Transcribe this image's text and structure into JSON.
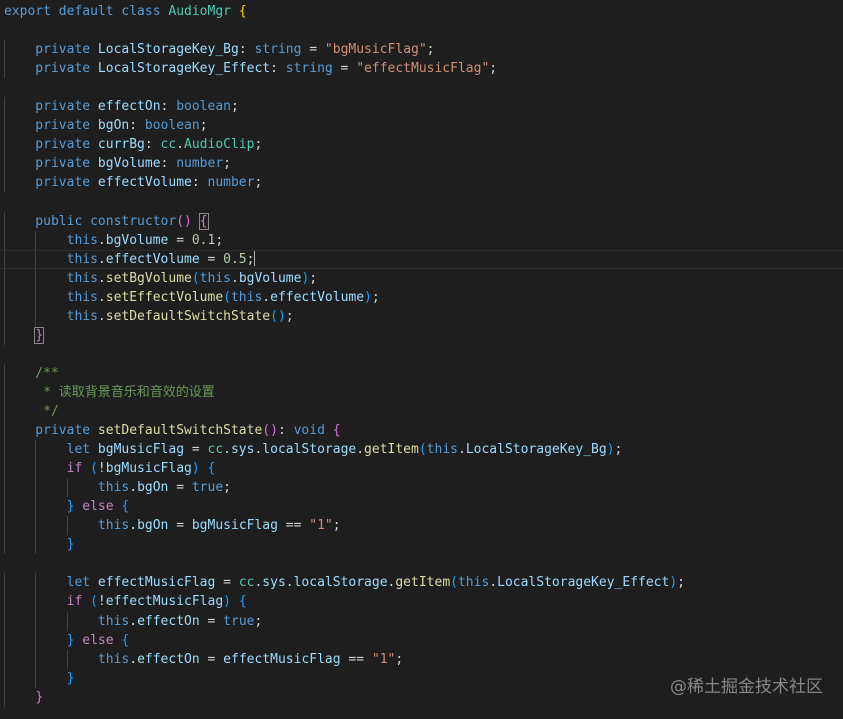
{
  "editor": {
    "lines": [
      [
        {
          "t": "export default class ",
          "c": "k"
        },
        {
          "t": "AudioMgr",
          "c": "cl"
        },
        {
          "t": " ",
          "c": "p"
        },
        {
          "t": "{",
          "c": "br1"
        }
      ],
      [],
      [
        {
          "t": "    private ",
          "c": "k"
        },
        {
          "t": "LocalStorageKey_Bg",
          "c": "v"
        },
        {
          "t": ": ",
          "c": "p"
        },
        {
          "t": "string",
          "c": "k"
        },
        {
          "t": " = ",
          "c": "p"
        },
        {
          "t": "\"bgMusicFlag\"",
          "c": "s"
        },
        {
          "t": ";",
          "c": "p"
        }
      ],
      [
        {
          "t": "    private ",
          "c": "k"
        },
        {
          "t": "LocalStorageKey_Effect",
          "c": "v"
        },
        {
          "t": ": ",
          "c": "p"
        },
        {
          "t": "string",
          "c": "k"
        },
        {
          "t": " = ",
          "c": "p"
        },
        {
          "t": "\"effectMusicFlag\"",
          "c": "s"
        },
        {
          "t": ";",
          "c": "p"
        }
      ],
      [],
      [
        {
          "t": "    private ",
          "c": "k"
        },
        {
          "t": "effectOn",
          "c": "v"
        },
        {
          "t": ": ",
          "c": "p"
        },
        {
          "t": "boolean",
          "c": "k"
        },
        {
          "t": ";",
          "c": "p"
        }
      ],
      [
        {
          "t": "    private ",
          "c": "k"
        },
        {
          "t": "bgOn",
          "c": "v"
        },
        {
          "t": ": ",
          "c": "p"
        },
        {
          "t": "boolean",
          "c": "k"
        },
        {
          "t": ";",
          "c": "p"
        }
      ],
      [
        {
          "t": "    private ",
          "c": "k"
        },
        {
          "t": "currBg",
          "c": "v"
        },
        {
          "t": ": ",
          "c": "p"
        },
        {
          "t": "cc",
          "c": "cl"
        },
        {
          "t": ".",
          "c": "p"
        },
        {
          "t": "AudioClip",
          "c": "cl"
        },
        {
          "t": ";",
          "c": "p"
        }
      ],
      [
        {
          "t": "    private ",
          "c": "k"
        },
        {
          "t": "bgVolume",
          "c": "v"
        },
        {
          "t": ": ",
          "c": "p"
        },
        {
          "t": "number",
          "c": "k"
        },
        {
          "t": ";",
          "c": "p"
        }
      ],
      [
        {
          "t": "    private ",
          "c": "k"
        },
        {
          "t": "effectVolume",
          "c": "v"
        },
        {
          "t": ": ",
          "c": "p"
        },
        {
          "t": "number",
          "c": "k"
        },
        {
          "t": ";",
          "c": "p"
        }
      ],
      [],
      [
        {
          "t": "    public ",
          "c": "k"
        },
        {
          "t": "constructor",
          "c": "k"
        },
        {
          "t": "() ",
          "c": "br2"
        },
        {
          "t": "{",
          "c": "br2 bm"
        }
      ],
      [
        {
          "t": "        this",
          "c": "k"
        },
        {
          "t": ".",
          "c": "p"
        },
        {
          "t": "bgVolume",
          "c": "v"
        },
        {
          "t": " = ",
          "c": "p"
        },
        {
          "t": "0.1",
          "c": "n"
        },
        {
          "t": ";",
          "c": "p"
        }
      ],
      [
        {
          "t": "        this",
          "c": "k"
        },
        {
          "t": ".",
          "c": "p"
        },
        {
          "t": "effectVolume",
          "c": "v"
        },
        {
          "t": " = ",
          "c": "p"
        },
        {
          "t": "0.5",
          "c": "n"
        },
        {
          "t": ";",
          "c": "p"
        },
        {
          "t": "",
          "c": "cursor"
        }
      ],
      [
        {
          "t": "        this",
          "c": "k"
        },
        {
          "t": ".",
          "c": "p"
        },
        {
          "t": "setBgVolume",
          "c": "f"
        },
        {
          "t": "(",
          "c": "br3"
        },
        {
          "t": "this",
          "c": "k"
        },
        {
          "t": ".",
          "c": "p"
        },
        {
          "t": "bgVolume",
          "c": "v"
        },
        {
          "t": ")",
          "c": "br3"
        },
        {
          "t": ";",
          "c": "p"
        }
      ],
      [
        {
          "t": "        this",
          "c": "k"
        },
        {
          "t": ".",
          "c": "p"
        },
        {
          "t": "setEffectVolume",
          "c": "f"
        },
        {
          "t": "(",
          "c": "br3"
        },
        {
          "t": "this",
          "c": "k"
        },
        {
          "t": ".",
          "c": "p"
        },
        {
          "t": "effectVolume",
          "c": "v"
        },
        {
          "t": ")",
          "c": "br3"
        },
        {
          "t": ";",
          "c": "p"
        }
      ],
      [
        {
          "t": "        this",
          "c": "k"
        },
        {
          "t": ".",
          "c": "p"
        },
        {
          "t": "setDefaultSwitchState",
          "c": "f"
        },
        {
          "t": "()",
          "c": "br3"
        },
        {
          "t": ";",
          "c": "p"
        }
      ],
      [
        {
          "t": "    ",
          "c": "p"
        },
        {
          "t": "}",
          "c": "br2 bm"
        }
      ],
      [],
      [
        {
          "t": "    /**",
          "c": "cm"
        }
      ],
      [
        {
          "t": "     * 读取背景音乐和音效的设置",
          "c": "cm"
        }
      ],
      [
        {
          "t": "     */",
          "c": "cm"
        }
      ],
      [
        {
          "t": "    private ",
          "c": "k"
        },
        {
          "t": "setDefaultSwitchState",
          "c": "f"
        },
        {
          "t": "()",
          "c": "br2"
        },
        {
          "t": ": ",
          "c": "p"
        },
        {
          "t": "void",
          "c": "k"
        },
        {
          "t": " ",
          "c": "p"
        },
        {
          "t": "{",
          "c": "br2"
        }
      ],
      [
        {
          "t": "        let ",
          "c": "k"
        },
        {
          "t": "bgMusicFlag",
          "c": "v"
        },
        {
          "t": " = ",
          "c": "p"
        },
        {
          "t": "cc",
          "c": "cl"
        },
        {
          "t": ".",
          "c": "p"
        },
        {
          "t": "sys",
          "c": "v"
        },
        {
          "t": ".",
          "c": "p"
        },
        {
          "t": "localStorage",
          "c": "v"
        },
        {
          "t": ".",
          "c": "p"
        },
        {
          "t": "getItem",
          "c": "f"
        },
        {
          "t": "(",
          "c": "br3"
        },
        {
          "t": "this",
          "c": "k"
        },
        {
          "t": ".",
          "c": "p"
        },
        {
          "t": "LocalStorageKey_Bg",
          "c": "v"
        },
        {
          "t": ")",
          "c": "br3"
        },
        {
          "t": ";",
          "c": "p"
        }
      ],
      [
        {
          "t": "        if ",
          "c": "kc"
        },
        {
          "t": "(",
          "c": "br3"
        },
        {
          "t": "!",
          "c": "p"
        },
        {
          "t": "bgMusicFlag",
          "c": "v"
        },
        {
          "t": ")",
          "c": "br3"
        },
        {
          "t": " ",
          "c": "p"
        },
        {
          "t": "{",
          "c": "br3"
        }
      ],
      [
        {
          "t": "            this",
          "c": "k"
        },
        {
          "t": ".",
          "c": "p"
        },
        {
          "t": "bgOn",
          "c": "v"
        },
        {
          "t": " = ",
          "c": "p"
        },
        {
          "t": "true",
          "c": "k"
        },
        {
          "t": ";",
          "c": "p"
        }
      ],
      [
        {
          "t": "        ",
          "c": "p"
        },
        {
          "t": "}",
          "c": "br3"
        },
        {
          "t": " else ",
          "c": "kc"
        },
        {
          "t": "{",
          "c": "br3"
        }
      ],
      [
        {
          "t": "            this",
          "c": "k"
        },
        {
          "t": ".",
          "c": "p"
        },
        {
          "t": "bgOn",
          "c": "v"
        },
        {
          "t": " = ",
          "c": "p"
        },
        {
          "t": "bgMusicFlag",
          "c": "v"
        },
        {
          "t": " == ",
          "c": "p"
        },
        {
          "t": "\"1\"",
          "c": "s"
        },
        {
          "t": ";",
          "c": "p"
        }
      ],
      [
        {
          "t": "        ",
          "c": "p"
        },
        {
          "t": "}",
          "c": "br3"
        }
      ],
      [],
      [
        {
          "t": "        let ",
          "c": "k"
        },
        {
          "t": "effectMusicFlag",
          "c": "v"
        },
        {
          "t": " = ",
          "c": "p"
        },
        {
          "t": "cc",
          "c": "cl"
        },
        {
          "t": ".",
          "c": "p"
        },
        {
          "t": "sys",
          "c": "v"
        },
        {
          "t": ".",
          "c": "p"
        },
        {
          "t": "localStorage",
          "c": "v"
        },
        {
          "t": ".",
          "c": "p"
        },
        {
          "t": "getItem",
          "c": "f"
        },
        {
          "t": "(",
          "c": "br3"
        },
        {
          "t": "this",
          "c": "k"
        },
        {
          "t": ".",
          "c": "p"
        },
        {
          "t": "LocalStorageKey_Effect",
          "c": "v"
        },
        {
          "t": ")",
          "c": "br3"
        },
        {
          "t": ";",
          "c": "p"
        }
      ],
      [
        {
          "t": "        if ",
          "c": "kc"
        },
        {
          "t": "(",
          "c": "br3"
        },
        {
          "t": "!",
          "c": "p"
        },
        {
          "t": "effectMusicFlag",
          "c": "v"
        },
        {
          "t": ")",
          "c": "br3"
        },
        {
          "t": " ",
          "c": "p"
        },
        {
          "t": "{",
          "c": "br3"
        }
      ],
      [
        {
          "t": "            this",
          "c": "k"
        },
        {
          "t": ".",
          "c": "p"
        },
        {
          "t": "effectOn",
          "c": "v"
        },
        {
          "t": " = ",
          "c": "p"
        },
        {
          "t": "true",
          "c": "k"
        },
        {
          "t": ";",
          "c": "p"
        }
      ],
      [
        {
          "t": "        ",
          "c": "p"
        },
        {
          "t": "}",
          "c": "br3"
        },
        {
          "t": " else ",
          "c": "kc"
        },
        {
          "t": "{",
          "c": "br3"
        }
      ],
      [
        {
          "t": "            this",
          "c": "k"
        },
        {
          "t": ".",
          "c": "p"
        },
        {
          "t": "effectOn",
          "c": "v"
        },
        {
          "t": " = ",
          "c": "p"
        },
        {
          "t": "effectMusicFlag",
          "c": "v"
        },
        {
          "t": " == ",
          "c": "p"
        },
        {
          "t": "\"1\"",
          "c": "s"
        },
        {
          "t": ";",
          "c": "p"
        }
      ],
      [
        {
          "t": "        ",
          "c": "p"
        },
        {
          "t": "}",
          "c": "br3"
        }
      ],
      [
        {
          "t": "    ",
          "c": "p"
        },
        {
          "t": "}",
          "c": "br2"
        }
      ]
    ],
    "current_line": 13
  },
  "theme": {
    "background": "#1e1e1e",
    "keyword": "#569cd6",
    "control_keyword": "#c586c0",
    "class_name": "#4ec9b0",
    "variable": "#9cdcfe",
    "function": "#dcdcaa",
    "string": "#ce9178",
    "number": "#b5cea8",
    "comment": "#6a9955"
  },
  "watermark": "@稀土掘金技术社区"
}
